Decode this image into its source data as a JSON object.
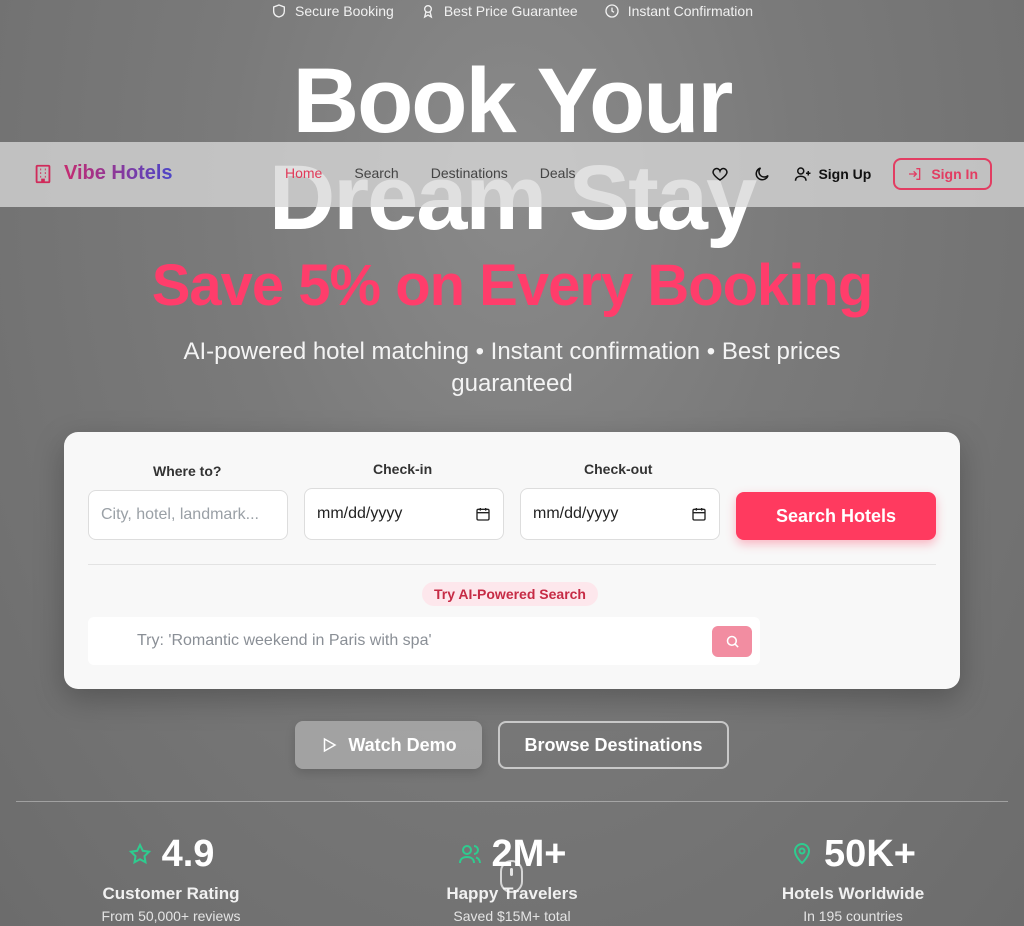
{
  "trust_bar": [
    {
      "label": "Secure Booking",
      "icon": "shield-icon"
    },
    {
      "label": "Best Price Guarantee",
      "icon": "award-icon"
    },
    {
      "label": "Instant Confirmation",
      "icon": "clock-icon"
    }
  ],
  "hero": {
    "title_line1": "Book Your",
    "title_line2": "Dream Stay",
    "highlight": "Save 5% on Every Booking",
    "subtitle": "AI-powered hotel matching • Instant confirmation • Best prices guaranteed"
  },
  "nav": {
    "brand": "Vibe Hotels",
    "links": [
      "Home",
      "Search",
      "Destinations",
      "Deals"
    ],
    "active_link": "Home",
    "signup_label": "Sign Up",
    "signin_label": "Sign In"
  },
  "search": {
    "where_label": "Where to?",
    "where_placeholder": "City, hotel, landmark...",
    "checkin_label": "Check-in",
    "checkin_value": "mm/dd/yyyy",
    "checkout_label": "Check-out",
    "checkout_value": "mm/dd/yyyy",
    "button_label": "Search Hotels",
    "ai_badge": "Try AI-Powered Search",
    "ai_placeholder": "Try: 'Romantic weekend in Paris with spa'"
  },
  "actions": {
    "watch_demo": "Watch Demo",
    "browse": "Browse Destinations"
  },
  "stats": [
    {
      "value": "4.9",
      "label": "Customer Rating",
      "sub": "From 50,000+ reviews",
      "icon": "star-icon"
    },
    {
      "value": "2M+",
      "label": "Happy Travelers",
      "sub": "Saved $15M+ total",
      "icon": "users-icon"
    },
    {
      "value": "50K+",
      "label": "Hotels Worldwide",
      "sub": "In 195 countries",
      "icon": "map-pin-icon"
    }
  ],
  "colors": {
    "accent": "#ff3a5f",
    "stat_icon": "#2ecc8f",
    "brand_gradient_start": "#c62b6f",
    "brand_gradient_end": "#4b46c8"
  }
}
